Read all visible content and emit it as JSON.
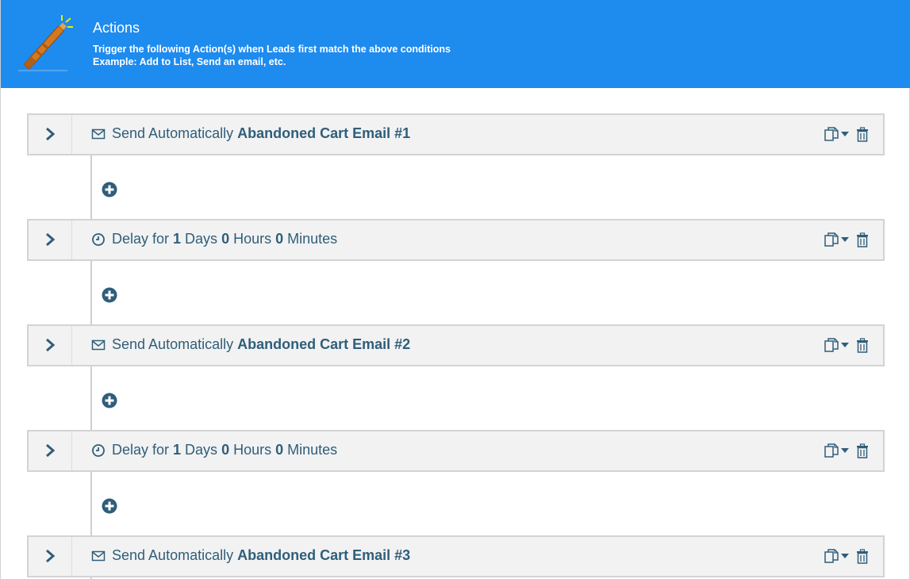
{
  "header": {
    "title": "Actions",
    "line1": "Trigger the following Action(s) when Leads first match the above conditions",
    "line2": "Example: Add to List, Send an email, etc.",
    "colors": {
      "background": "#1e8bef",
      "text": "#ffffff"
    },
    "icon": "magic-wand-icon"
  },
  "actions": [
    {
      "type": "email",
      "icon": "envelope-icon",
      "prefix": "Send Automatically",
      "name": "Abandoned Cart Email #1"
    },
    {
      "type": "delay",
      "icon": "clock-icon",
      "prefix": "Delay for",
      "days": "1",
      "days_label": "Days",
      "hours": "0",
      "hours_label": "Hours",
      "minutes": "0",
      "minutes_label": "Minutes"
    },
    {
      "type": "email",
      "icon": "envelope-icon",
      "prefix": "Send Automatically",
      "name": "Abandoned Cart Email #2"
    },
    {
      "type": "delay",
      "icon": "clock-icon",
      "prefix": "Delay for",
      "days": "1",
      "days_label": "Days",
      "hours": "0",
      "hours_label": "Hours",
      "minutes": "0",
      "minutes_label": "Minutes"
    },
    {
      "type": "email",
      "icon": "envelope-icon",
      "prefix": "Send Automatically",
      "name": "Abandoned Cart Email #3"
    }
  ],
  "row_tools": [
    "expand-chevron-icon",
    "copy-icon",
    "caret-down-icon",
    "trash-icon"
  ],
  "add_button_icon": "plus-circle-icon",
  "colors": {
    "accent": "#2f5e7a",
    "row_bg": "#f2f2f2",
    "row_border": "#d3d3d3"
  }
}
